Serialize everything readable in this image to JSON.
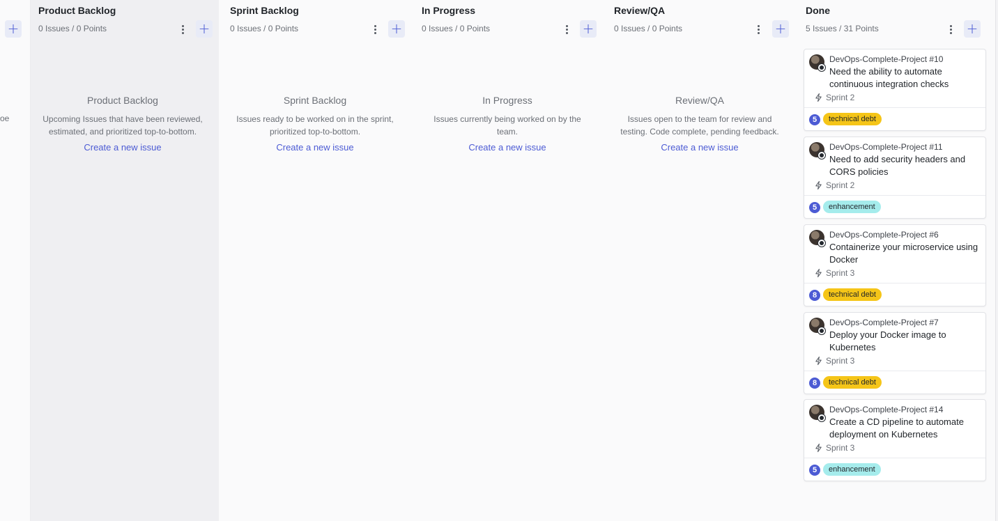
{
  "left_clip_text": "oe",
  "columns": [
    {
      "title": "Product Backlog",
      "meta": "0 Issues / 0 Points",
      "empty_title": "Product Backlog",
      "empty_desc_1": "Upcoming Issues that have been reviewed,",
      "empty_desc_2": "estimated, and prioritized top-to-bottom.",
      "link": "Create a new issue"
    },
    {
      "title": "Sprint Backlog",
      "meta": "0 Issues / 0 Points",
      "empty_title": "Sprint Backlog",
      "empty_desc_1": "Issues ready to be worked on in the sprint,",
      "empty_desc_2": "prioritized top-to-bottom.",
      "link": "Create a new issue"
    },
    {
      "title": "In Progress",
      "meta": "0 Issues / 0 Points",
      "empty_title": "In Progress",
      "empty_desc_1": "Issues currently being worked on by the",
      "empty_desc_2": "team.",
      "link": "Create a new issue"
    },
    {
      "title": "Review/QA",
      "meta": "0 Issues / 0 Points",
      "empty_title": "Review/QA",
      "empty_desc_1": "Issues open to the team for review and",
      "empty_desc_2": "testing. Code complete, pending feedback.",
      "link": "Create a new issue"
    },
    {
      "title": "Done",
      "meta": "5 Issues / 31 Points"
    }
  ],
  "cards": [
    {
      "repo": "DevOps-Complete-Project #10",
      "title": "Need the ability to automate continuous integration checks",
      "sprint": "Sprint 2",
      "points": "5",
      "label": "technical debt",
      "label_color": "#f5c518"
    },
    {
      "repo": "DevOps-Complete-Project #11",
      "title": "Need to add security headers and CORS policies",
      "sprint": "Sprint 2",
      "points": "5",
      "label": "enhancement",
      "label_color": "#a5ecec"
    },
    {
      "repo": "DevOps-Complete-Project #6",
      "title": "Containerize your microservice using Docker",
      "sprint": "Sprint 3",
      "points": "8",
      "label": "technical debt",
      "label_color": "#f5c518"
    },
    {
      "repo": "DevOps-Complete-Project #7",
      "title": "Deploy your Docker image to Kubernetes",
      "sprint": "Sprint 3",
      "points": "8",
      "label": "technical debt",
      "label_color": "#f5c518"
    },
    {
      "repo": "DevOps-Complete-Project #14",
      "title": "Create a CD pipeline to automate deployment on Kubernetes",
      "sprint": "Sprint 3",
      "points": "5",
      "label": "enhancement",
      "label_color": "#a5ecec"
    }
  ],
  "icons": {
    "plus": "plus-icon",
    "kebab": "kebab-menu-icon",
    "sprint": "lightning-bolt-icon",
    "avatar": "user-avatar",
    "github": "github-icon"
  },
  "colors": {
    "accent": "#4c5bd4",
    "technical_debt": "#f5c518",
    "enhancement": "#a5ecec"
  }
}
